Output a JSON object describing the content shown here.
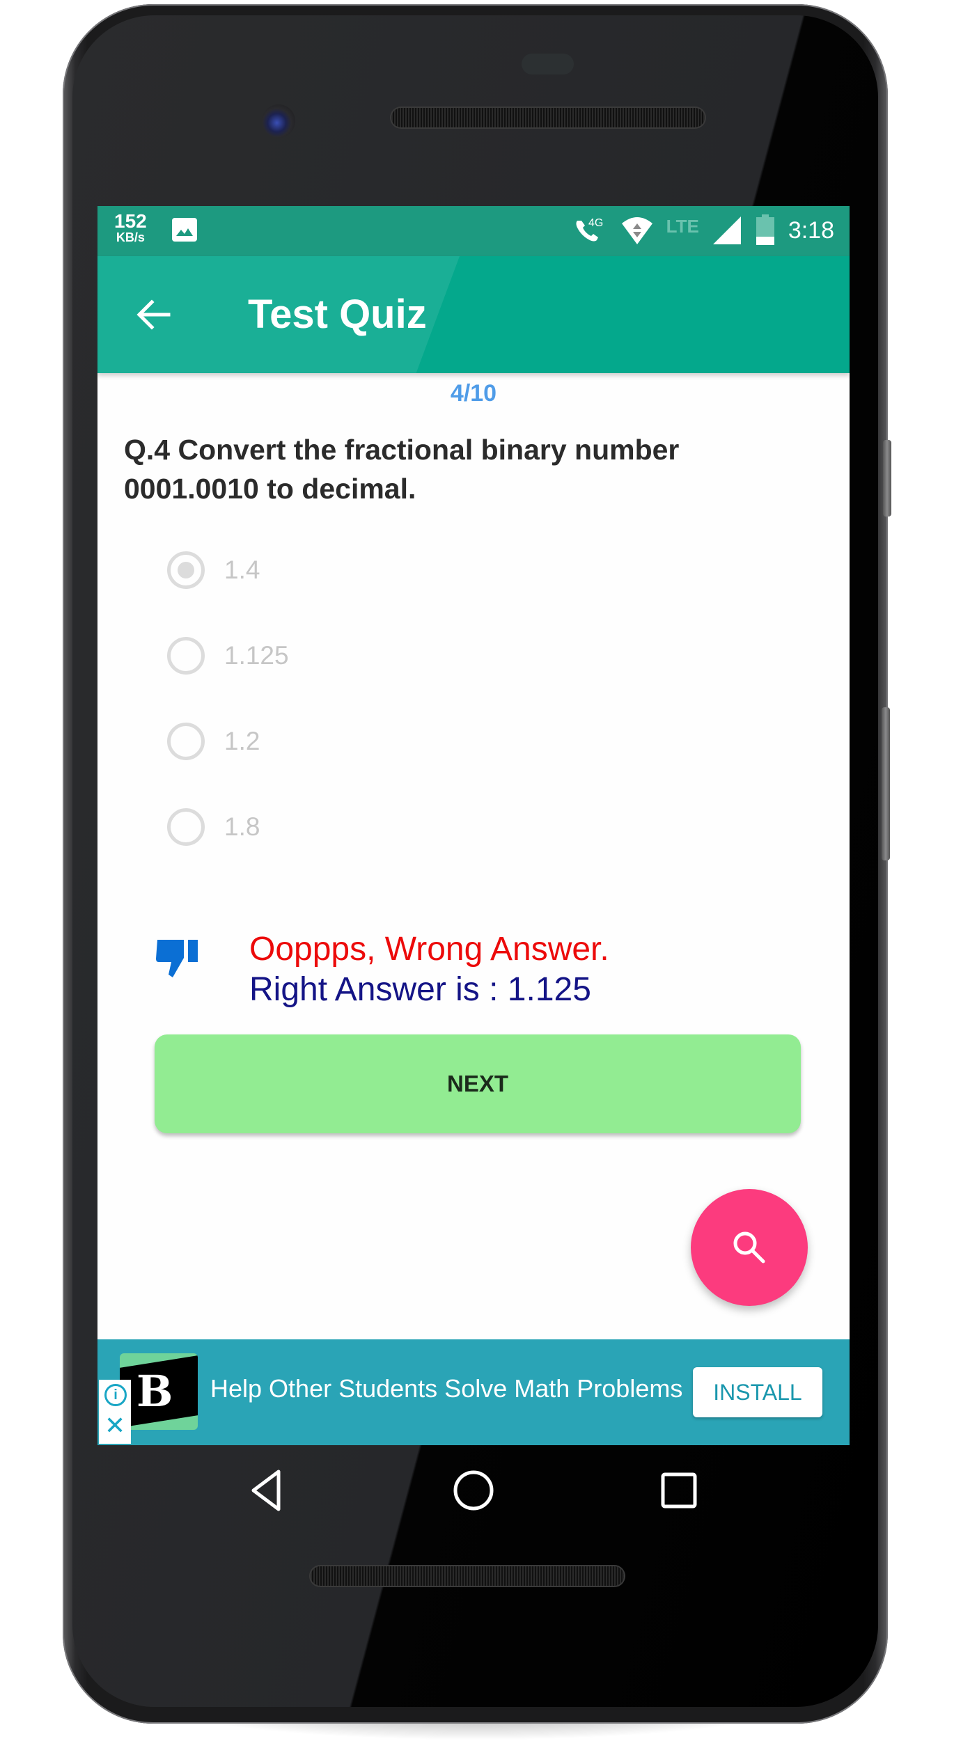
{
  "status_bar": {
    "net_speed_value": "152",
    "net_speed_unit": "KB/s",
    "notification_icon": "image-icon",
    "call_label": "4G",
    "lte_label": "LTE",
    "time": "3:18",
    "icons": [
      "volte-call-icon",
      "wifi-icon",
      "signal-icon",
      "battery-icon"
    ]
  },
  "app_bar": {
    "back_icon": "arrow-left-icon",
    "title": "Test Quiz",
    "color": "#04a88c"
  },
  "quiz": {
    "progress": "4/10",
    "question": "Q.4 Convert the fractional binary number 0001.0010 to decimal.",
    "options": [
      {
        "label": "1.4",
        "selected": true
      },
      {
        "label": "1.125",
        "selected": false
      },
      {
        "label": "1.2",
        "selected": false
      },
      {
        "label": "1.8",
        "selected": false
      }
    ],
    "feedback": {
      "icon": "thumbs-down-icon",
      "wrong_text": "Ooppps, Wrong Answer.",
      "right_text": "Right Answer is : 1.125",
      "wrong_color": "#ec0a0a",
      "right_color": "#141486"
    },
    "next_label": "NEXT"
  },
  "fab": {
    "icon": "search-icon",
    "color": "#fc3b7e"
  },
  "ad_banner": {
    "logo_letter": "B",
    "info_icon": "info-icon",
    "close_icon": "close-icon",
    "text": "Help Other Students Solve Math Problems",
    "install_label": "INSTALL",
    "color": "#2aa4b6"
  },
  "nav_bar": {
    "buttons": [
      "back-triangle-icon",
      "home-circle-icon",
      "recents-square-icon"
    ]
  }
}
